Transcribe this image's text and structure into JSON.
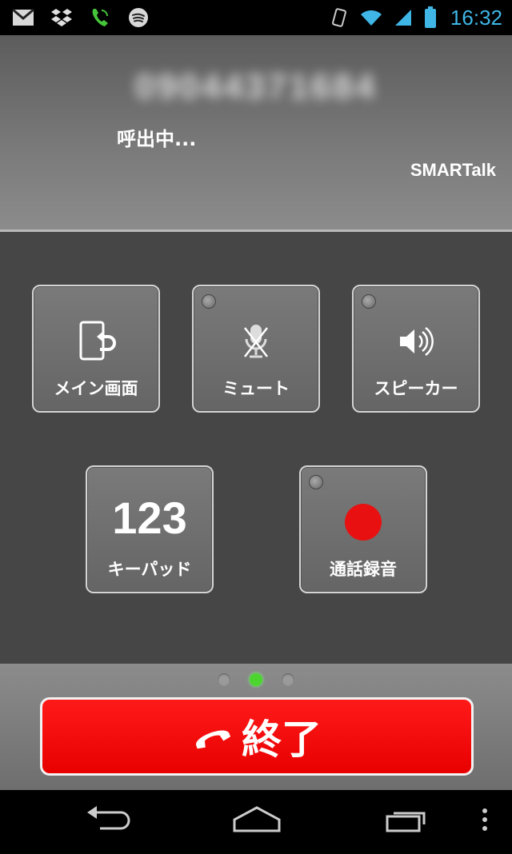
{
  "status_bar": {
    "left_icons": [
      "gmail-icon",
      "dropbox-icon",
      "phone-call-icon",
      "spotify-icon"
    ],
    "right_icons": [
      "vibrate-icon",
      "wifi-icon",
      "signal-icon",
      "battery-icon"
    ],
    "time": "16:32"
  },
  "caller": {
    "number": "09044371684",
    "status": "呼出中...",
    "app_name": "SMARTalk"
  },
  "controls": {
    "main_screen": {
      "label": "メイン画面",
      "icon": "return-to-main-icon"
    },
    "mute": {
      "label": "ミュート",
      "icon": "mic-muted-icon"
    },
    "speaker": {
      "label": "スピーカー",
      "icon": "speaker-icon"
    },
    "keypad": {
      "label": "キーパッド",
      "number": "123"
    },
    "record": {
      "label": "通話録音",
      "icon": "record-icon"
    }
  },
  "pager": {
    "count": 3,
    "active_index": 1
  },
  "end_call": {
    "label": "終了",
    "icon": "hang-up-icon"
  },
  "navbar": {
    "icons": [
      "back-icon",
      "home-icon",
      "recent-apps-icon",
      "menu-icon"
    ]
  },
  "colors": {
    "clock": "#3fb6e6",
    "end_button": "#ff0000",
    "record_dot": "#e81010",
    "active_dot": "#4cd52e"
  }
}
